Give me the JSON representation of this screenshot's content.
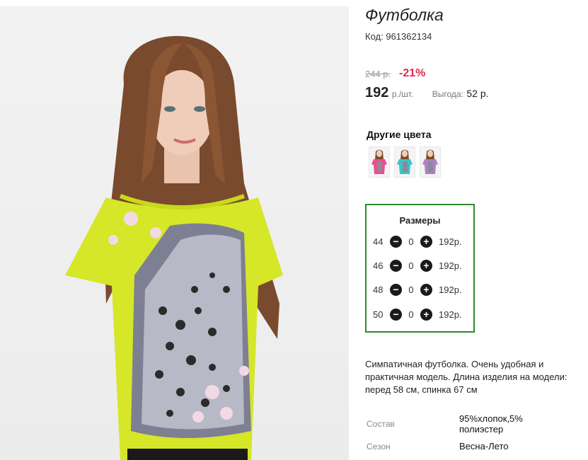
{
  "product": {
    "title": "Футболка",
    "code_label": "Код:",
    "code": "961362134",
    "old_price": "244 р.",
    "discount": "-21%",
    "price": "192",
    "unit": "р./шт.",
    "savings_label": "Выгода:",
    "savings_value": "52 р."
  },
  "other_colors": {
    "title": "Другие цвета",
    "swatches": [
      {
        "name": "pink",
        "color": "#e8508a"
      },
      {
        "name": "turquoise",
        "color": "#3ec2c6"
      },
      {
        "name": "lilac",
        "color": "#b07fc4"
      }
    ]
  },
  "sizes": {
    "title": "Размеры",
    "rows": [
      {
        "size": "44",
        "qty": "0",
        "price": "192р."
      },
      {
        "size": "46",
        "qty": "0",
        "price": "192р."
      },
      {
        "size": "48",
        "qty": "0",
        "price": "192р."
      },
      {
        "size": "50",
        "qty": "0",
        "price": "192р."
      }
    ],
    "minus_glyph": "−",
    "plus_glyph": "+"
  },
  "description": "Симпатичная футболка. Очень удобная и практичная модель. Длина изделия на модели: перед 58 см, спинка 67 см",
  "specs": [
    {
      "label": "Состав",
      "value": "95%хлопок,5% полиэстер"
    },
    {
      "label": "Сезон",
      "value": "Весна-Лето"
    }
  ],
  "colors": {
    "accent_red": "#e0284f",
    "box_green": "#2e8b2e",
    "shirt": "#d6e628"
  }
}
